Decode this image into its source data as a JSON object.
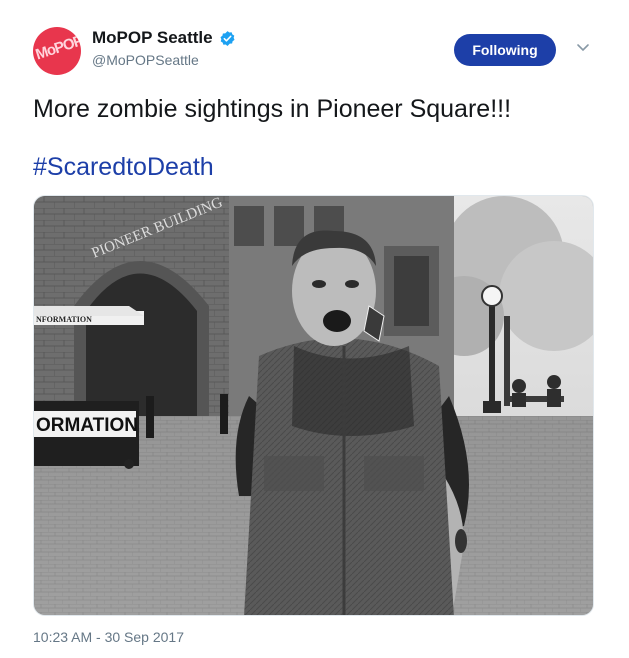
{
  "account": {
    "display_name": "MoPOP Seattle",
    "handle": "@MoPOPSeattle",
    "avatar_text": "MoPOP",
    "verified": true
  },
  "actions": {
    "follow_label": "Following"
  },
  "tweet": {
    "text": "More zombie sightings in Pioneer Square!!!",
    "hashtag": "#ScaredtoDeath",
    "timestamp": "10:23 AM - 30 Sep 2017"
  },
  "photo": {
    "sign_large": "ORMATION",
    "sign_small": "NFORMATION",
    "arch_text": "PIONEER BUILDING"
  },
  "colors": {
    "accent": "#1d3fa8",
    "avatar_bg": "#e8364d",
    "verified": "#1da1f2",
    "muted_text": "#657786"
  }
}
